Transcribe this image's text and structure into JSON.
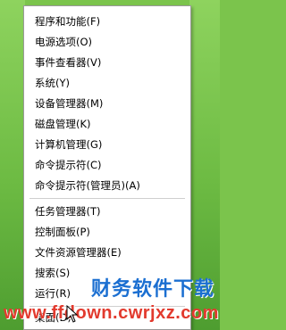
{
  "menu": {
    "group1": [
      "程序和功能(F)",
      "电源选项(O)",
      "事件查看器(V)",
      "系统(Y)",
      "设备管理器(M)",
      "磁盘管理(K)",
      "计算机管理(G)",
      "命令提示符(C)",
      "命令提示符(管理员)(A)"
    ],
    "group2": [
      "任务管理器(T)",
      "控制面板(P)",
      "文件资源管理器(E)",
      "搜索(S)",
      "运行(R)"
    ],
    "group3": [
      "桌面(D)"
    ]
  },
  "watermark": {
    "site": "www.ffdown.cwrjxz.com",
    "title": "财务软件下载"
  }
}
